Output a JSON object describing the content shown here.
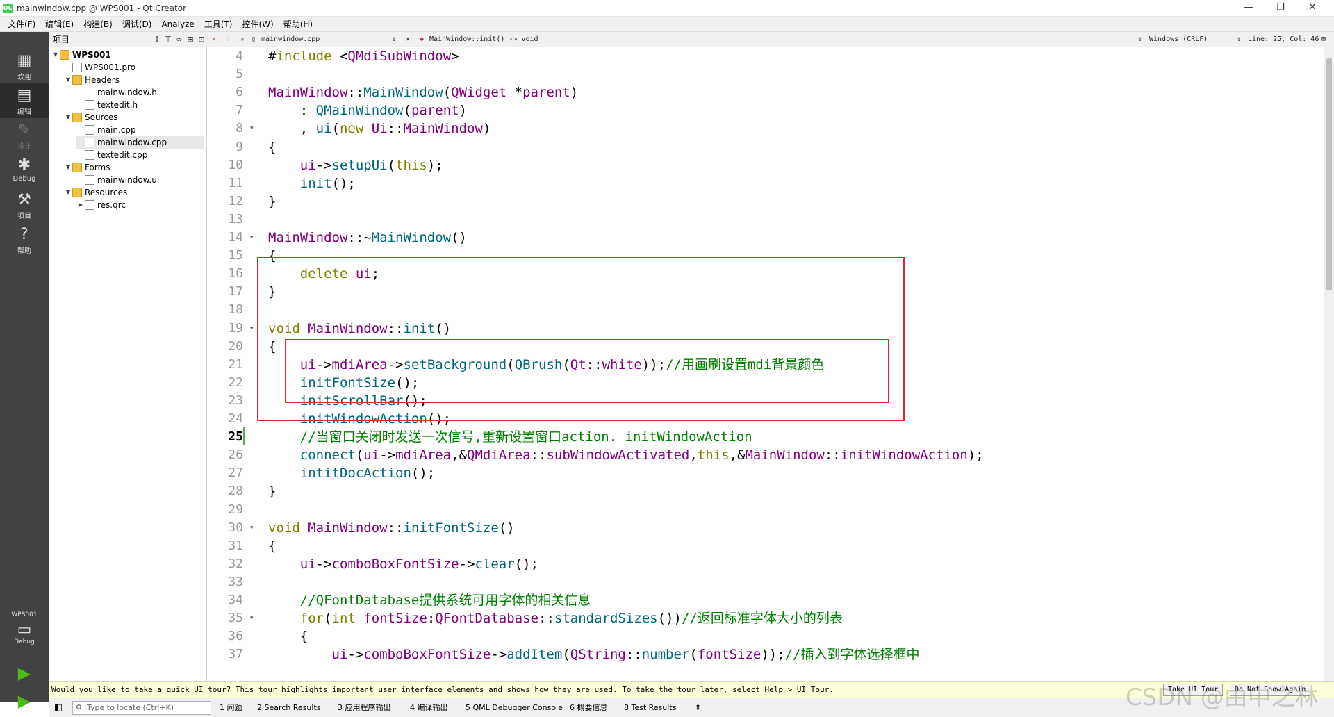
{
  "window": {
    "title": "mainwindow.cpp @ WPS001 - Qt Creator",
    "logo": "QC",
    "controls": [
      "—",
      "❐",
      "✕"
    ]
  },
  "menu": [
    "文件(F)",
    "编辑(E)",
    "构建(B)",
    "调试(D)",
    "Analyze",
    "工具(T)",
    "控件(W)",
    "帮助(H)"
  ],
  "modes": [
    {
      "label": "欢迎",
      "icon": "grid-icon"
    },
    {
      "label": "编辑",
      "icon": "edit-icon"
    },
    {
      "label": "设计",
      "icon": "pencil-icon"
    },
    {
      "label": "Debug",
      "icon": "bug-icon"
    },
    {
      "label": "项目",
      "icon": "wrench-icon"
    },
    {
      "label": "帮助",
      "icon": "help-icon"
    }
  ],
  "kit": {
    "project": "WPS001",
    "mode": "Debug"
  },
  "project_panel": {
    "label": "项目",
    "tree": [
      {
        "name": "WPS001",
        "level": 0,
        "type": "project"
      },
      {
        "name": "WPS001.pro",
        "level": 1,
        "type": "file"
      },
      {
        "name": "Headers",
        "level": 1,
        "type": "folder"
      },
      {
        "name": "mainwindow.h",
        "level": 2,
        "type": "file"
      },
      {
        "name": "textedit.h",
        "level": 2,
        "type": "file"
      },
      {
        "name": "Sources",
        "level": 1,
        "type": "folder"
      },
      {
        "name": "main.cpp",
        "level": 2,
        "type": "file"
      },
      {
        "name": "mainwindow.cpp",
        "level": 2,
        "type": "file"
      },
      {
        "name": "textedit.cpp",
        "level": 2,
        "type": "file"
      },
      {
        "name": "Forms",
        "level": 1,
        "type": "folder"
      },
      {
        "name": "mainwindow.ui",
        "level": 2,
        "type": "file"
      },
      {
        "name": "Resources",
        "level": 1,
        "type": "folder"
      },
      {
        "name": "res.qrc",
        "level": 2,
        "type": "file"
      }
    ]
  },
  "editor_toolbar": {
    "file": "mainwindow.cpp",
    "symbol": "MainWindow::init() -> void",
    "line_ending": "Windows (CRLF)",
    "position": "Line: 25, Col: 46"
  },
  "code": {
    "current_line": 25,
    "lines": [
      {
        "n": 4,
        "text": "#include <QMdiSubWindow>"
      },
      {
        "n": 5,
        "text": ""
      },
      {
        "n": 6,
        "text": "MainWindow::MainWindow(QWidget *parent)"
      },
      {
        "n": 7,
        "text": "    : QMainWindow(parent)"
      },
      {
        "n": 8,
        "text": "    , ui(new Ui::MainWindow)"
      },
      {
        "n": 9,
        "text": "{"
      },
      {
        "n": 10,
        "text": "    ui->setupUi(this);"
      },
      {
        "n": 11,
        "text": "    init();"
      },
      {
        "n": 12,
        "text": "}"
      },
      {
        "n": 13,
        "text": ""
      },
      {
        "n": 14,
        "text": "MainWindow::~MainWindow()"
      },
      {
        "n": 15,
        "text": "{"
      },
      {
        "n": 16,
        "text": "    delete ui;"
      },
      {
        "n": 17,
        "text": "}"
      },
      {
        "n": 18,
        "text": ""
      },
      {
        "n": 19,
        "text": "void MainWindow::init()"
      },
      {
        "n": 20,
        "text": "{"
      },
      {
        "n": 21,
        "text": "    ui->mdiArea->setBackground(QBrush(Qt::white));//用画刷设置mdi背景颜色"
      },
      {
        "n": 22,
        "text": "    initFontSize();"
      },
      {
        "n": 23,
        "text": "    initScrollBar();"
      },
      {
        "n": 24,
        "text": "    initWindowAction();"
      },
      {
        "n": 25,
        "text": "    //当窗口关闭时发送一次信号,重新设置窗口action. initWindowAction"
      },
      {
        "n": 26,
        "text": "    connect(ui->mdiArea,&QMdiArea::subWindowActivated,this,&MainWindow::initWindowAction);"
      },
      {
        "n": 27,
        "text": "    intitDocAction();"
      },
      {
        "n": 28,
        "text": "}"
      },
      {
        "n": 29,
        "text": ""
      },
      {
        "n": 30,
        "text": "void MainWindow::initFontSize()"
      },
      {
        "n": 31,
        "text": "{"
      },
      {
        "n": 32,
        "text": "    ui->comboBoxFontSize->clear();"
      },
      {
        "n": 33,
        "text": ""
      },
      {
        "n": 34,
        "text": "    //QFontDatabase提供系统可用字体的相关信息"
      },
      {
        "n": 35,
        "text": "    for(int fontSize:QFontDatabase::standardSizes())//返回标准字体大小的列表"
      },
      {
        "n": 36,
        "text": "    {"
      },
      {
        "n": 37,
        "text": "        ui->comboBoxFontSize->addItem(QString::number(fontSize));//插入到字体选择框中"
      }
    ]
  },
  "infobar": {
    "message": "Would you like to take a quick UI tour? This tour highlights important user interface elements and shows how they are used. To take the tour later, select Help > UI Tour.",
    "take_tour": "Take UI Tour",
    "dont_show": "Do Not Show Again"
  },
  "statusbar": {
    "locator_placeholder": "Type to locate (Ctrl+K)",
    "tabs": [
      "1 问题",
      "2 Search Results",
      "3 应用程序输出",
      "4 编译输出",
      "5 QML Debugger Console",
      "6 概要信息",
      "8 Test Results"
    ]
  },
  "watermark": "CSDN @由中之林",
  "colors": {
    "keyword": "#808000",
    "type": "#800080",
    "function": "#00677c",
    "comment": "#008000",
    "highlight_box": "#e02828"
  }
}
